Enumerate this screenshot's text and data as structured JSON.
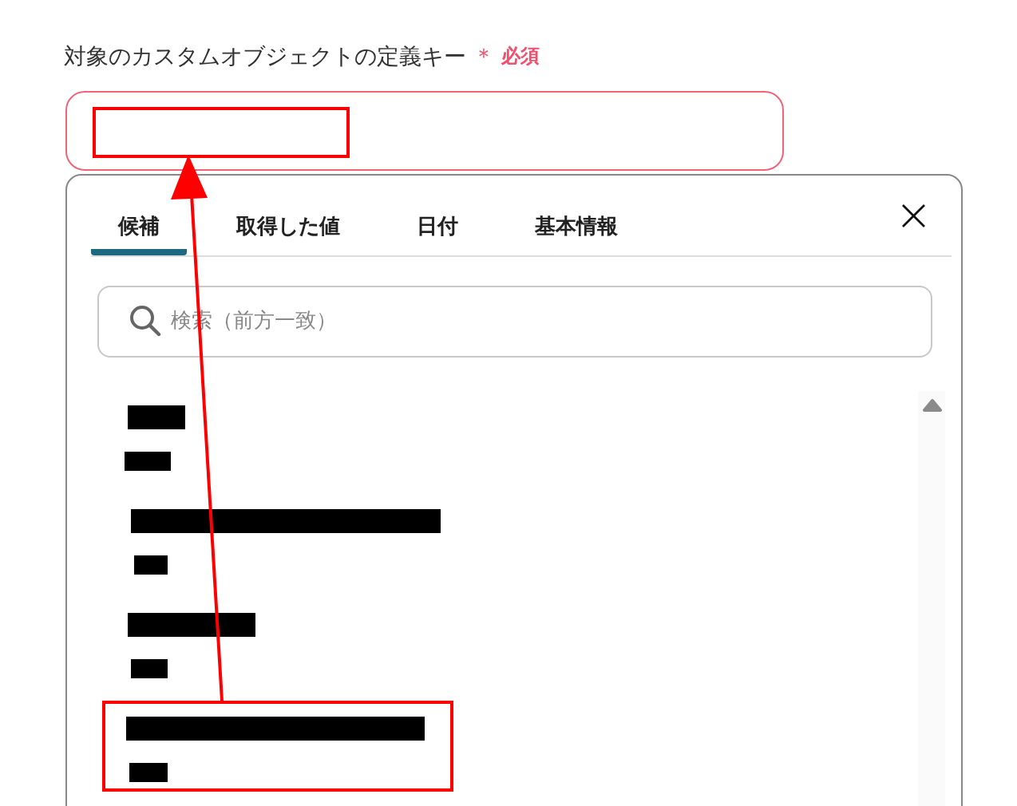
{
  "field": {
    "label": "対象のカスタムオブジェクトの定義キー",
    "required_mark": "＊",
    "required_text": "必須"
  },
  "tabs": [
    {
      "label": "候補",
      "selected": true
    },
    {
      "label": "取得した値",
      "selected": false
    },
    {
      "label": "日付",
      "selected": false
    },
    {
      "label": "基本情報",
      "selected": false
    }
  ],
  "close": {
    "symbol": "×"
  },
  "search": {
    "placeholder": "検索（前方一致）"
  },
  "candidates": [
    {
      "kind": "redacted"
    },
    {
      "kind": "redacted"
    },
    {
      "kind": "redacted"
    },
    {
      "kind": "redacted"
    }
  ]
}
